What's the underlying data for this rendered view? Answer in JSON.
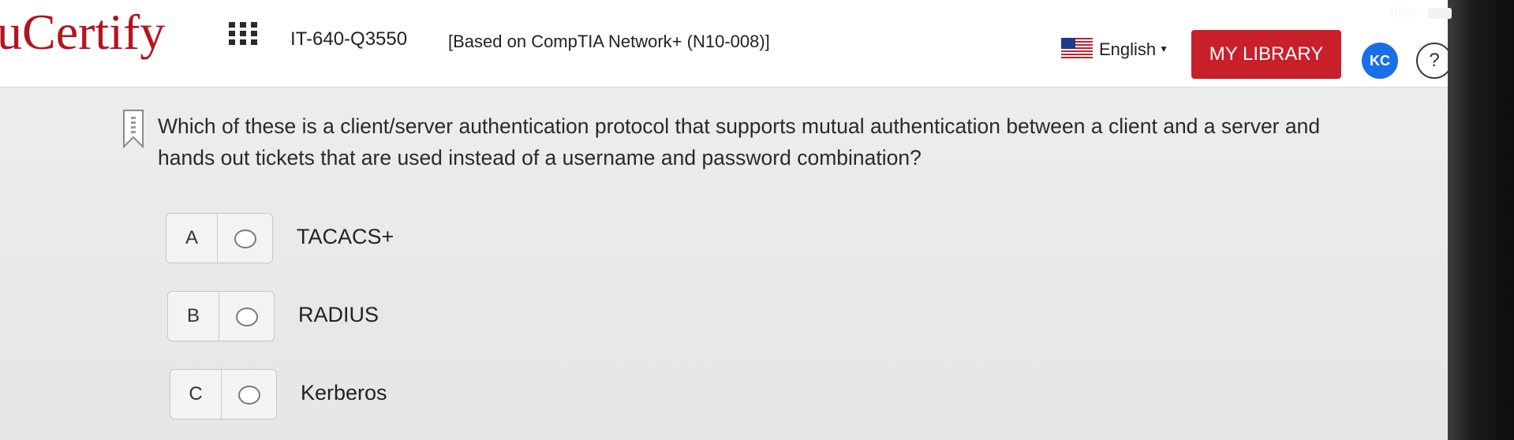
{
  "status": {
    "battery": "99%"
  },
  "header": {
    "logo": "uCertify",
    "course_code": "IT-640-Q3550",
    "course_name": "[Based on CompTIA Network+ (N10-008)]",
    "language": "English",
    "library_label": "MY LIBRARY",
    "avatar_initials": "KC",
    "help_label": "?",
    "accent_color": "#c8202b"
  },
  "question": {
    "text": "Which of these is a client/server authentication protocol that supports mutual authentication between a client and a server and hands out tickets that are used instead of a username and password combination?",
    "options": [
      {
        "letter": "A",
        "label": "TACACS+"
      },
      {
        "letter": "B",
        "label": "RADIUS"
      },
      {
        "letter": "C",
        "label": "Kerberos"
      }
    ]
  }
}
